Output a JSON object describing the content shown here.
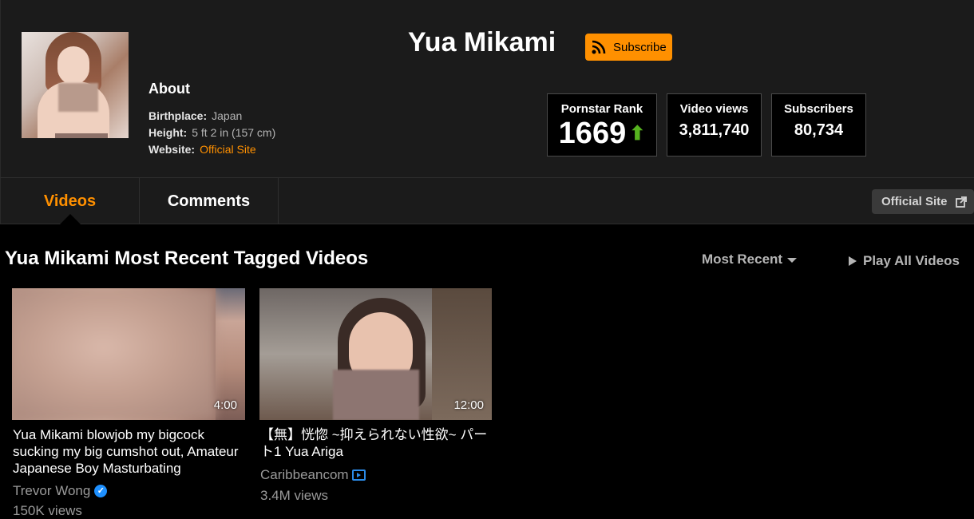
{
  "profile": {
    "name": "Yua Mikami",
    "subscribe_label": "Subscribe",
    "about_title": "About",
    "birthplace_label": "Birthplace:",
    "birthplace_value": "Japan",
    "height_label": "Height:",
    "height_value": "5 ft 2 in (157 cm)",
    "website_label": "Website:",
    "website_value": "Official Site"
  },
  "stats": {
    "rank_label": "Pornstar Rank",
    "rank_value": "1669",
    "views_label": "Video views",
    "views_value": "3,811,740",
    "subs_label": "Subscribers",
    "subs_value": "80,734"
  },
  "tabs": [
    {
      "label": "Videos"
    },
    {
      "label": "Comments"
    }
  ],
  "official_site_button": "Official Site",
  "section": {
    "title": "Yua Mikami Most Recent Tagged Videos",
    "sort_label": "Most Recent",
    "play_all_label": "Play All Videos"
  },
  "videos": [
    {
      "duration": "4:00",
      "title": "Yua Mikami blowjob my bigcock sucking my big cumshot out, Amateur Japanese Boy Masturbating",
      "uploader": "Trevor Wong",
      "views": "150K views"
    },
    {
      "duration": "12:00",
      "title": "【無】恍惚 ~抑えられない性欲~ パート1 Yua Ariga",
      "uploader": "Caribbeancom",
      "views": "3.4M views"
    }
  ],
  "colors": {
    "accent": "#ff9000",
    "rank_up": "#56b31f",
    "verified": "#1e90ff"
  }
}
